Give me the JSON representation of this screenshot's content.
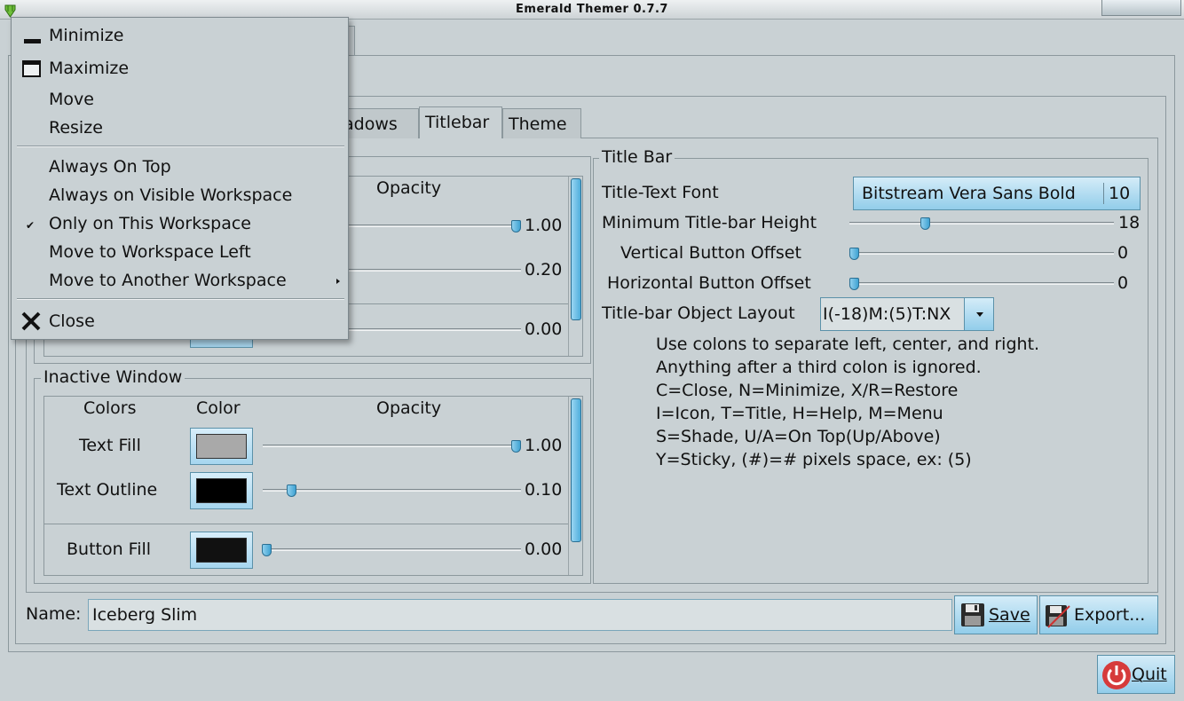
{
  "window": {
    "title": "Emerald Themer 0.7.7"
  },
  "tabs": [
    {
      "label": "adows"
    },
    {
      "label": "Titlebar"
    },
    {
      "label": "Theme"
    }
  ],
  "active_window": {
    "opacity_header": "Opacity",
    "rows": [
      {
        "value": "1.00",
        "level": 1.0
      },
      {
        "value": "0.20",
        "level": 0.2
      },
      {
        "value": "0.00",
        "level": 0.0
      }
    ]
  },
  "inactive_window": {
    "title": "Inactive Window",
    "headers": {
      "colors": "Colors",
      "color": "Color",
      "opacity": "Opacity"
    },
    "rows": [
      {
        "label": "Text Fill",
        "swatch": "#a9a9a9",
        "value": "1.00",
        "level": 1.0
      },
      {
        "label": "Text Outline",
        "swatch": "#000000",
        "value": "0.10",
        "level": 0.1
      },
      {
        "label": "Button Fill",
        "swatch": "#111111",
        "value": "0.00",
        "level": 0.0
      }
    ]
  },
  "title_bar": {
    "group_title": "Title Bar",
    "font_label": "Title-Text Font",
    "font_name": "Bitstream Vera Sans Bold",
    "font_size": "10",
    "min_height_label": "Minimum Title-bar Height",
    "min_height_value": "18",
    "min_height_level": 0.29,
    "vert_offset_label": "Vertical Button Offset",
    "vert_offset_value": "0",
    "horiz_offset_label": "Horizontal Button Offset",
    "horiz_offset_value": "0",
    "layout_label": "Title-bar Object Layout",
    "layout_value": "I(-18)M:(5)T:NX",
    "help": [
      "Use colons to separate left, center, and right.",
      "Anything after a third colon is ignored.",
      "C=Close, N=Minimize, X/R=Restore",
      "I=Icon, T=Title, H=Help, M=Menu",
      "S=Shade, U/A=On Top(Up/Above)",
      "Y=Sticky, (#)=# pixels space, ex: (5)"
    ]
  },
  "footer": {
    "name_label": "Name:",
    "name_value": "Iceberg Slim",
    "save_label": "Save",
    "export_label": "Export...",
    "quit_label": "Quit"
  },
  "window_menu": {
    "items": [
      {
        "label": "Minimize",
        "icon": "minimize-icon"
      },
      {
        "label": "Maximize",
        "icon": "maximize-icon"
      },
      {
        "label": "Move"
      },
      {
        "label": "Resize"
      },
      {
        "label": "Always On Top"
      },
      {
        "label": "Always on Visible Workspace"
      },
      {
        "label": "Only on This Workspace",
        "checked": true
      },
      {
        "label": "Move to Workspace Left"
      },
      {
        "label": "Move to Another Workspace",
        "submenu": true
      },
      {
        "label": "Close",
        "icon": "close-icon"
      }
    ]
  }
}
